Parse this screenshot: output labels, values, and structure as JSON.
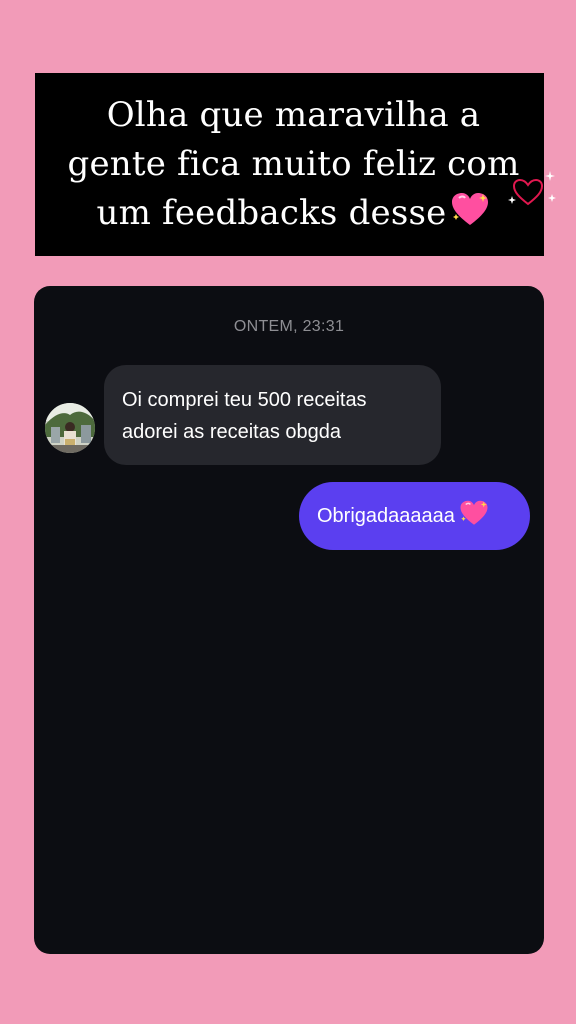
{
  "caption": {
    "lines": [
      "Olha que maravilha a",
      "gente fica muito feliz com",
      "um feedbacks desse"
    ],
    "emoji": "sparkling-heart-icon"
  },
  "sticker": {
    "icon": "heart-outline-sparkles-icon",
    "color": "#e0184f"
  },
  "chat": {
    "timestamp": "ONTEM, 23:31",
    "incoming": {
      "lines": [
        "Oi comprei teu 500 receitas",
        "adorei as receitas obgda"
      ]
    },
    "outgoing": {
      "text": "Obrigadaaaaaa",
      "emoji": "sparkling-heart-icon"
    }
  },
  "colors": {
    "background": "#f29bb8",
    "caption_box": "#000000",
    "chat_panel": "#0c0d12",
    "incoming_bubble": "#26272d",
    "outgoing_bubble": "#5b3ff0"
  }
}
